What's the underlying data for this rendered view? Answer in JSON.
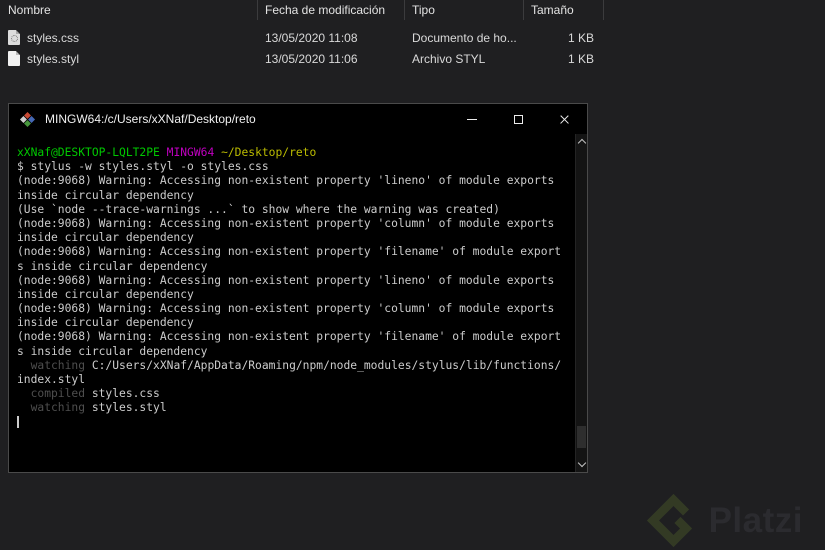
{
  "file_explorer": {
    "columns": [
      "Nombre",
      "Fecha de modificación",
      "Tipo",
      "Tamaño"
    ],
    "files": [
      {
        "name": "styles.css",
        "modified": "13/05/2020 11:08",
        "type": "Documento de ho...",
        "size": "1 KB",
        "icon": "css-file-icon"
      },
      {
        "name": "styles.styl",
        "modified": "13/05/2020 11:06",
        "type": "Archivo STYL",
        "size": "1 KB",
        "icon": "styl-file-icon"
      }
    ]
  },
  "terminal": {
    "title": "MINGW64:/c/Users/xXNaf/Desktop/reto",
    "colors": {
      "green": "#00c800",
      "magenta": "#c000c0",
      "yellow": "#bcbc00",
      "default": "#cccccc",
      "dim": "#4e4e4e",
      "background": "#000000"
    },
    "lines": [
      {
        "segments": [
          {
            "t": "xXNaf@DESKTOP-LQLT2PE ",
            "c": "green"
          },
          {
            "t": "MINGW64 ",
            "c": "magenta"
          },
          {
            "t": "~/Desktop/reto",
            "c": "yellow"
          }
        ]
      },
      {
        "segments": [
          {
            "t": "$ stylus -w styles.styl -o styles.css",
            "c": "default"
          }
        ]
      },
      {
        "segments": [
          {
            "t": "(node:9068) Warning: Accessing non-existent property 'lineno' of module exports",
            "c": "default"
          }
        ]
      },
      {
        "segments": [
          {
            "t": "inside circular dependency",
            "c": "default"
          }
        ]
      },
      {
        "segments": [
          {
            "t": "(Use `node --trace-warnings ...` to show where the warning was created)",
            "c": "default"
          }
        ]
      },
      {
        "segments": [
          {
            "t": "(node:9068) Warning: Accessing non-existent property 'column' of module exports",
            "c": "default"
          }
        ]
      },
      {
        "segments": [
          {
            "t": "inside circular dependency",
            "c": "default"
          }
        ]
      },
      {
        "segments": [
          {
            "t": "(node:9068) Warning: Accessing non-existent property 'filename' of module export",
            "c": "default"
          }
        ]
      },
      {
        "segments": [
          {
            "t": "s inside circular dependency",
            "c": "default"
          }
        ]
      },
      {
        "segments": [
          {
            "t": "(node:9068) Warning: Accessing non-existent property 'lineno' of module exports",
            "c": "default"
          }
        ]
      },
      {
        "segments": [
          {
            "t": "inside circular dependency",
            "c": "default"
          }
        ]
      },
      {
        "segments": [
          {
            "t": "(node:9068) Warning: Accessing non-existent property 'column' of module exports",
            "c": "default"
          }
        ]
      },
      {
        "segments": [
          {
            "t": "inside circular dependency",
            "c": "default"
          }
        ]
      },
      {
        "segments": [
          {
            "t": "(node:9068) Warning: Accessing non-existent property 'filename' of module export",
            "c": "default"
          }
        ]
      },
      {
        "segments": [
          {
            "t": "s inside circular dependency",
            "c": "default"
          }
        ]
      },
      {
        "segments": [
          {
            "t": "  watching ",
            "c": "dim"
          },
          {
            "t": "C:/Users/xXNaf/AppData/Roaming/npm/node_modules/stylus/lib/functions/",
            "c": "default"
          }
        ]
      },
      {
        "segments": [
          {
            "t": "index.styl",
            "c": "default"
          }
        ]
      },
      {
        "segments": [
          {
            "t": "  compiled ",
            "c": "dim"
          },
          {
            "t": "styles.css",
            "c": "default"
          }
        ]
      },
      {
        "segments": [
          {
            "t": "  watching ",
            "c": "dim"
          },
          {
            "t": "styles.styl",
            "c": "default"
          }
        ]
      },
      {
        "segments": [],
        "cursor": true
      }
    ]
  },
  "watermark": {
    "text": "Platzi",
    "logo_color": "#333a24",
    "text_color": "#2b2b2f"
  }
}
